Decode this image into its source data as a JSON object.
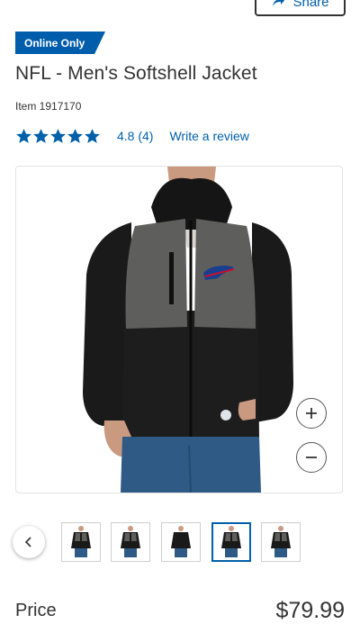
{
  "header": {
    "share_label": "Share"
  },
  "product": {
    "badge": "Online Only",
    "title": "NFL - Men's Softshell Jacket",
    "item_number": "Item  1917170",
    "rating_value": 4.8,
    "rating_text": "4.8  (4)",
    "review_link": "Write a review",
    "stars_count": 5
  },
  "gallery": {
    "thumbnails": [
      {
        "name": "thumb-front",
        "selected": false
      },
      {
        "name": "thumb-angle",
        "selected": false
      },
      {
        "name": "thumb-back",
        "selected": false
      },
      {
        "name": "thumb-closeup",
        "selected": true
      },
      {
        "name": "thumb-model",
        "selected": false
      }
    ]
  },
  "pricing": {
    "label": "Price",
    "value": "$79.99"
  },
  "colors": {
    "accent": "#0060a9",
    "badge_bg": "#005dab",
    "text": "#333333"
  }
}
